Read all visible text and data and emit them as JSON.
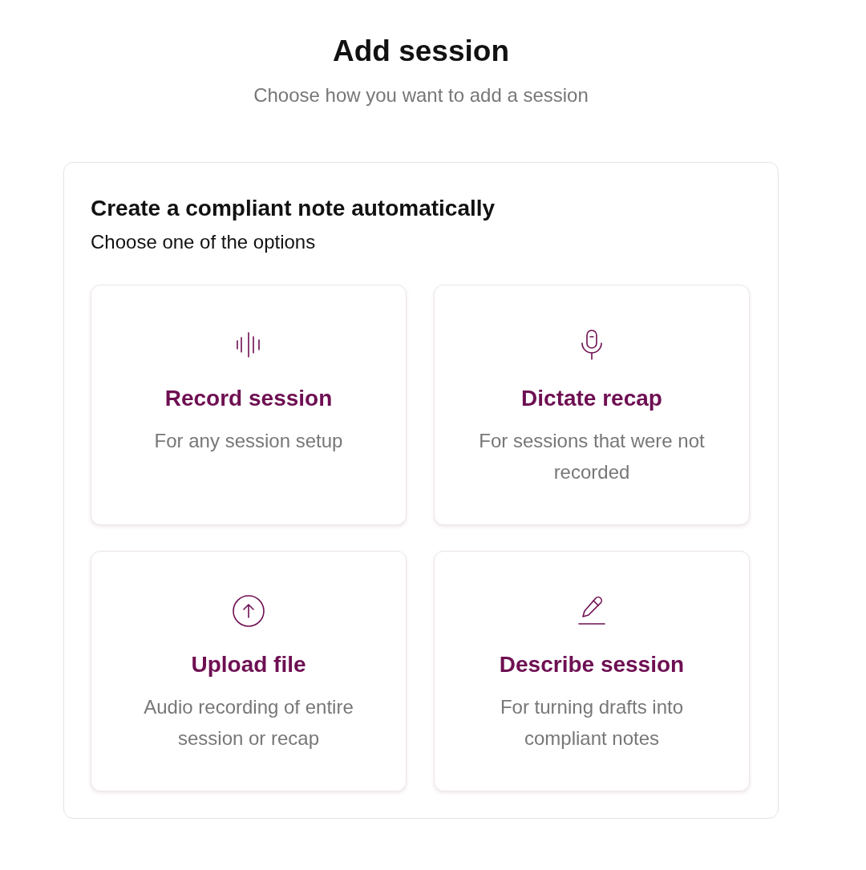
{
  "header": {
    "title": "Add session",
    "subtitle": "Choose how you want to add a session"
  },
  "panel": {
    "title": "Create a compliant note automatically",
    "subtitle": "Choose one of the options",
    "options": [
      {
        "kind": "record",
        "title": "Record session",
        "description": "For any session setup"
      },
      {
        "kind": "dictate",
        "title": "Dictate recap",
        "description": "For sessions that were not recorded"
      },
      {
        "kind": "upload",
        "title": "Upload file",
        "description": "Audio recording of entire session or recap"
      },
      {
        "kind": "describe",
        "title": "Describe session",
        "description": "For turning drafts into compliant notes"
      }
    ]
  }
}
